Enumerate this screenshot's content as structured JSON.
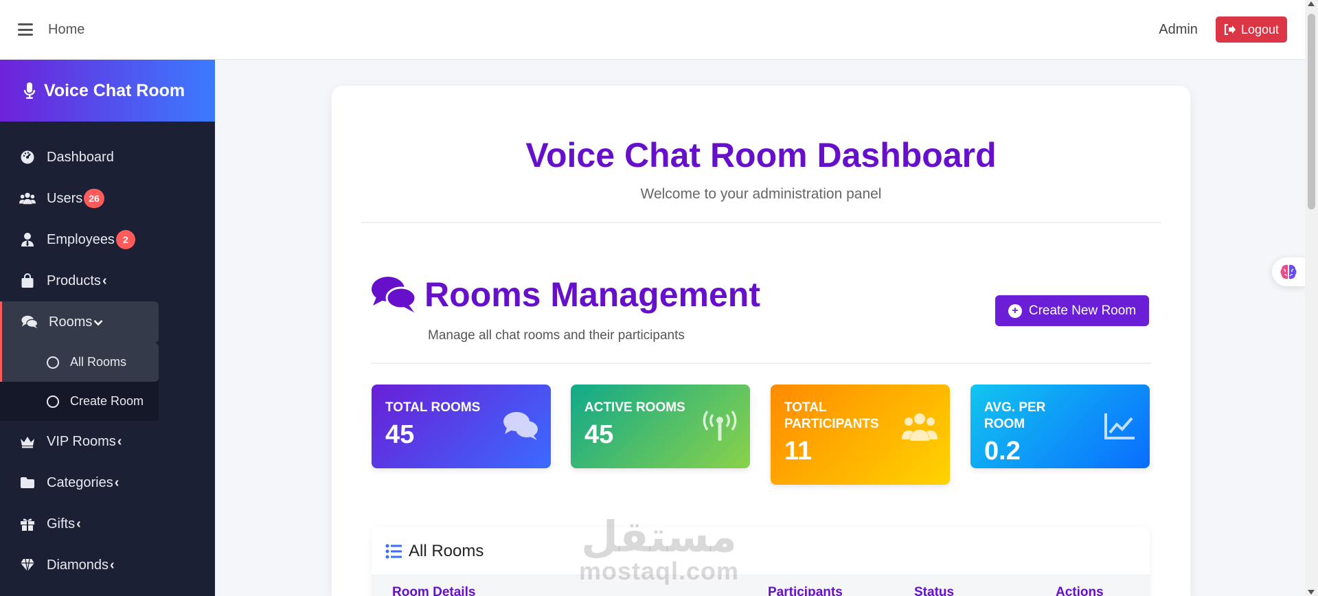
{
  "topbar": {
    "home_label": "Home",
    "admin_label": "Admin",
    "logout_label": "Logout"
  },
  "sidebar": {
    "brand": "Voice Chat Room",
    "items": [
      {
        "label": "Dashboard",
        "icon": "dashboard-icon"
      },
      {
        "label": "Users",
        "icon": "users-icon",
        "badge": "26"
      },
      {
        "label": "Employees",
        "icon": "employee-icon",
        "badge": "2"
      },
      {
        "label": "Products",
        "icon": "shopping-bag-icon",
        "chevron": "‹"
      },
      {
        "label": "Rooms",
        "icon": "comments-icon",
        "chevron": "⌄"
      },
      {
        "label": "VIP Rooms",
        "icon": "crown-icon",
        "chevron": "‹"
      },
      {
        "label": "Categories",
        "icon": "folder-icon",
        "chevron": "‹"
      },
      {
        "label": "Gifts",
        "icon": "gift-icon",
        "chevron": "‹"
      },
      {
        "label": "Diamonds",
        "icon": "gem-icon",
        "chevron": "‹"
      }
    ],
    "rooms_sub": [
      {
        "label": "All Rooms"
      },
      {
        "label": "Create Room"
      }
    ]
  },
  "main": {
    "title": "Voice Chat Room Dashboard",
    "subtitle": "Welcome to your administration panel",
    "section_title": "Rooms Management",
    "section_subtitle": "Manage all chat rooms and their participants",
    "create_button": "Create New Room",
    "stats": [
      {
        "label": "TOTAL ROOMS",
        "value": "45",
        "icon": "comments-icon"
      },
      {
        "label": "ACTIVE ROOMS",
        "value": "45",
        "icon": "broadcast-tower-icon"
      },
      {
        "label": "TOTAL PARTICIPANTS",
        "value": "11",
        "icon": "users-icon"
      },
      {
        "label": "AVG. PER ROOM",
        "value": "0.2",
        "icon": "line-chart-icon"
      }
    ],
    "rooms_table": {
      "title": "All Rooms",
      "columns": [
        "Room Details",
        "Participants",
        "Status",
        "Actions"
      ]
    }
  },
  "watermark": {
    "arabic": "مستقل",
    "latin": "mostaql.com"
  },
  "colors": {
    "accent": "#6610cc",
    "danger": "#dc3545",
    "sidebar": "#1b2035"
  }
}
